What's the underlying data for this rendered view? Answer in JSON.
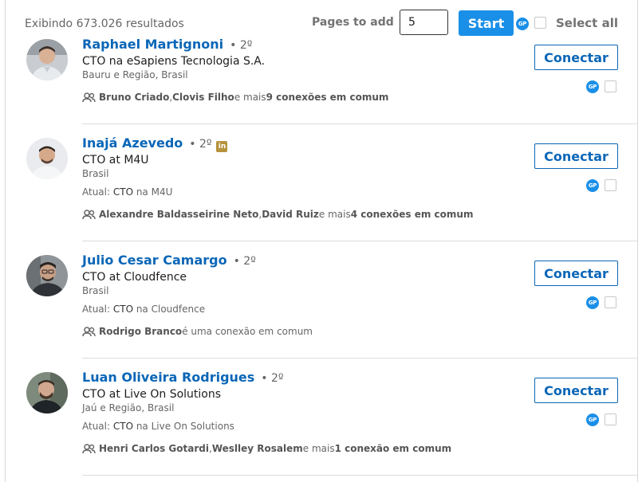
{
  "header": {
    "results_text": "Exibindo 673.026 resultados",
    "pages_label": "Pages to add",
    "pages_value": "5",
    "start_label": "Start",
    "gp_label": "GP",
    "select_all_label": "Select all"
  },
  "colors": {
    "accent": "#1a8fe8",
    "name_link": "#0a66b7",
    "linkedin_badge": "#b5923c"
  },
  "icons": {
    "shared": "people-icon",
    "badge": "linkedin-icon",
    "extension": "gp-icon"
  },
  "connect_label": "Conectar",
  "results": [
    {
      "name": "Raphael Martignoni",
      "degree": "• 2º",
      "headline": "CTO na eSapiens Tecnologia S.A.",
      "location": "Bauru e Região, Brasil",
      "shared_names": [
        "Bruno Criado",
        "Clovis Filho"
      ],
      "shared_sep": ", ",
      "shared_mid": " e mais ",
      "shared_count": "9 conexões em comum"
    },
    {
      "name": "Inajá Azevedo",
      "degree": "• 2º",
      "linkedin_badge": "in",
      "headline": "CTO at M4U",
      "location": "Brasil",
      "current_prefix": "Atual: ",
      "current_title": "CTO",
      "current_rest": " na M4U",
      "shared_names": [
        "Alexandre Baldasseirine Neto",
        "David Ruiz"
      ],
      "shared_sep": ", ",
      "shared_mid": " e mais ",
      "shared_count": "4 conexões em comum"
    },
    {
      "name": "Julio Cesar Camargo",
      "degree": "• 2º",
      "headline": "CTO at Cloudfence",
      "location": "Brasil",
      "current_prefix": "Atual: ",
      "current_title": "CTO",
      "current_rest": " na Cloudfence",
      "shared_single": "Rodrigo Branco",
      "shared_single_rest": " é uma conexão em comum"
    },
    {
      "name": "Luan Oliveira Rodrigues",
      "degree": "• 2º",
      "headline": "CTO at Live On Solutions",
      "location": "Jaú e Região, Brasil",
      "current_prefix": "Atual: ",
      "current_title": "CTO",
      "current_rest": " na Live On Solutions",
      "shared_names": [
        "Henri Carlos Gotardi",
        "Weslley Rosalem"
      ],
      "shared_sep": ", ",
      "shared_mid": " e mais ",
      "shared_count": "1 conexão em comum"
    }
  ]
}
